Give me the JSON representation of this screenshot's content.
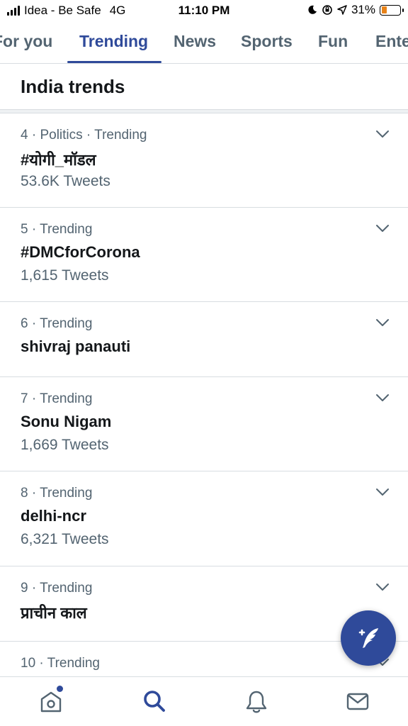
{
  "status_bar": {
    "carrier": "Idea - Be Safe",
    "network": "4G",
    "time": "11:10 PM",
    "battery_percent": "31%",
    "battery_level": 0.31
  },
  "tabs": [
    {
      "label": "For you",
      "active": false
    },
    {
      "label": "Trending",
      "active": true
    },
    {
      "label": "News",
      "active": false
    },
    {
      "label": "Sports",
      "active": false
    },
    {
      "label": "Fun",
      "active": false
    },
    {
      "label": "Entertainment",
      "active": false
    }
  ],
  "section": {
    "title": "India trends"
  },
  "trends": [
    {
      "meta": "4 · Politics · Trending",
      "name": "#योगी_मॉडल",
      "count": "53.6K Tweets"
    },
    {
      "meta": "5 · Trending",
      "name": "#DMCforCorona",
      "count": "1,615 Tweets"
    },
    {
      "meta": "6 · Trending",
      "name": "shivraj panauti",
      "count": ""
    },
    {
      "meta": "7 · Trending",
      "name": "Sonu Nigam",
      "count": "1,669 Tweets"
    },
    {
      "meta": "8 · Trending",
      "name": "delhi-ncr",
      "count": "6,321 Tweets"
    },
    {
      "meta": "9 · Trending",
      "name": "प्राचीन काल",
      "count": ""
    },
    {
      "meta": "10 · Trending",
      "name": "",
      "count": ""
    }
  ],
  "icons": {
    "home": "home-icon",
    "search": "search-icon",
    "notifications": "bell-icon",
    "messages": "mail-icon",
    "compose": "compose-tweet-icon",
    "chevron": "chevron-down-icon"
  },
  "colors": {
    "accent": "#2f4a9a",
    "secondary_text": "#536471",
    "battery": "#e8831a"
  }
}
